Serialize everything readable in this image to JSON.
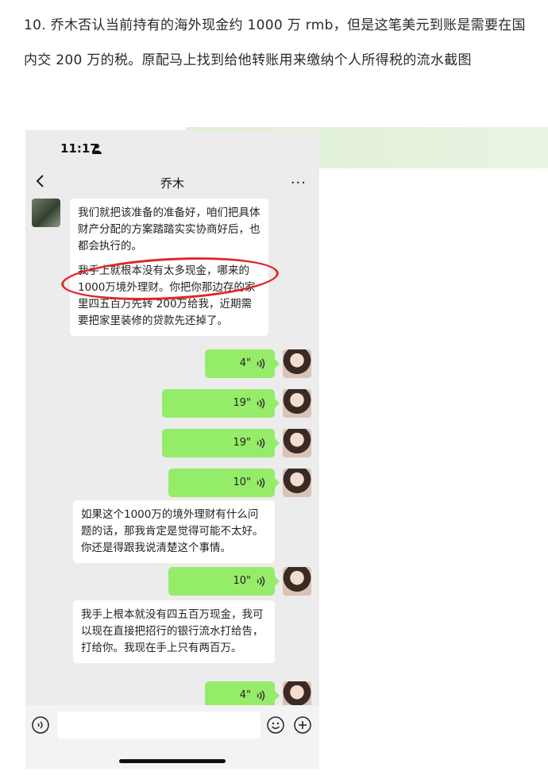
{
  "article": {
    "text": "10.  乔木否认当前持有的海外现金约 1000 万 rmb，但是这笔美元到账是需要在国内交 200 万的税。原配马上找到给他转账用来缴纳个人所得税的流水截图"
  },
  "status_bar": {
    "time": "11:17"
  },
  "chat": {
    "title": "乔木",
    "back_icon": "back-chevron-icon",
    "more_icon": "more-dots-icon",
    "more_label": "···"
  },
  "messages": [
    {
      "side": "in",
      "p1": "我们就把该准备的准备好，咱们把具体财产分配的方案踏踏实实协商好后，也都会执行的。",
      "p2": "我手上就根本没有太多现金，哪来的1000万境外理财。你把你那边存的家里四五百万先转 200万给我，近期需要把家里装修的贷款先还掉了。"
    },
    {
      "side": "out",
      "duration": "4\""
    },
    {
      "side": "out",
      "duration": "19\""
    },
    {
      "side": "out",
      "duration": "19\""
    },
    {
      "side": "out",
      "duration": "10\""
    },
    {
      "side": "in",
      "text": "如果这个1000万的境外理财有什么问题的话，那我肯定是觉得可能不太好。你还是得跟我说清楚这个事情。"
    },
    {
      "side": "out",
      "duration": "10\""
    },
    {
      "side": "in",
      "text": "我手上根本就没有四五百万现金，我可以现在直接把招行的银行流水打给告，打给你。我现在手上只有两百万。"
    },
    {
      "side": "out",
      "duration": "4\""
    }
  ],
  "input_bar": {
    "placeholder": "",
    "icons": [
      "voice-toggle-icon",
      "emoji-icon",
      "plus-icon"
    ]
  },
  "colors": {
    "outgoing_bubble": "#95ec69",
    "incoming_bubble": "#ffffff",
    "chat_background": "#ececec",
    "annotation_circle": "#e0262c"
  }
}
